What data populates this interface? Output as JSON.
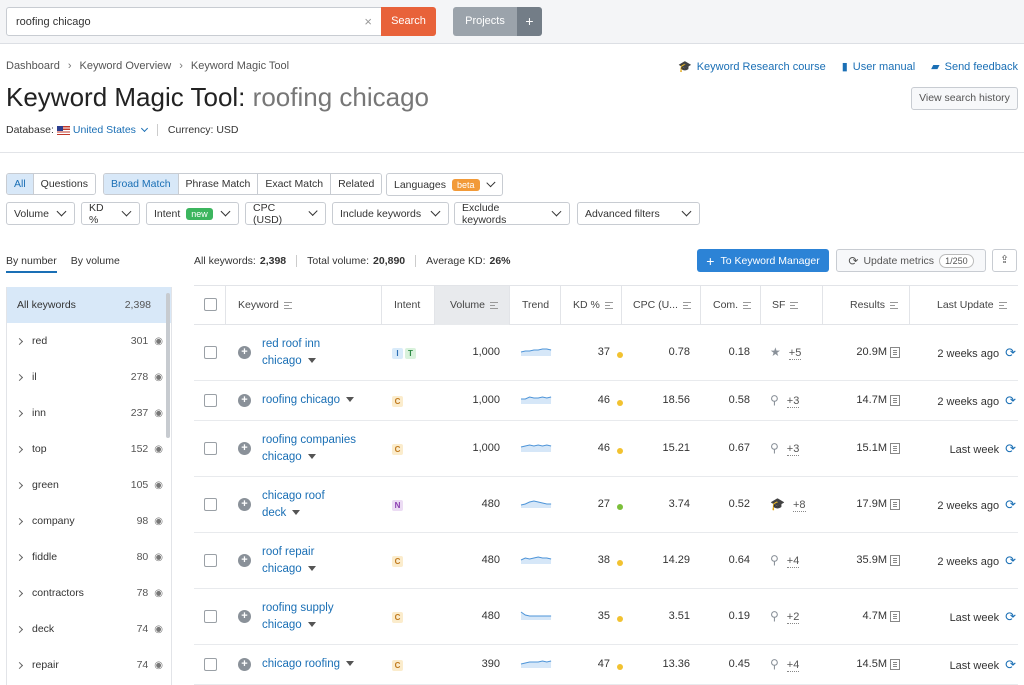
{
  "search": {
    "value": "roofing chicago",
    "clear": "×",
    "button": "Search"
  },
  "projects": {
    "label": "Projects",
    "plus": "+"
  },
  "breadcrumb": [
    "Dashboard",
    "Keyword Overview",
    "Keyword Magic Tool"
  ],
  "breadcrumb_sep": "›",
  "top_links": [
    "Keyword Research course",
    "User manual",
    "Send feedback"
  ],
  "title": {
    "tool": "Keyword Magic Tool:",
    "query": "roofing chicago"
  },
  "history_button": "View search history",
  "database": {
    "label": "Database:",
    "country": "United States",
    "currency": "Currency: USD"
  },
  "match_tabs_a": [
    "All",
    "Questions"
  ],
  "match_tabs_b": [
    "Broad Match",
    "Phrase Match",
    "Exact Match",
    "Related"
  ],
  "languages": {
    "label": "Languages",
    "badge": "beta"
  },
  "filters": {
    "volume": "Volume",
    "kd": "KD %",
    "intent": "Intent",
    "intent_badge": "new",
    "cpc": "CPC (USD)",
    "include": "Include keywords",
    "exclude": "Exclude keywords",
    "advanced": "Advanced filters"
  },
  "left_panel": {
    "tabs": [
      "By number",
      "By volume"
    ],
    "all": {
      "label": "All keywords",
      "count": "2,398"
    },
    "groups": [
      {
        "label": "red",
        "count": "301"
      },
      {
        "label": "il",
        "count": "278"
      },
      {
        "label": "inn",
        "count": "237"
      },
      {
        "label": "top",
        "count": "152"
      },
      {
        "label": "green",
        "count": "105"
      },
      {
        "label": "company",
        "count": "98"
      },
      {
        "label": "fiddle",
        "count": "80"
      },
      {
        "label": "contractors",
        "count": "78"
      },
      {
        "label": "deck",
        "count": "74"
      },
      {
        "label": "repair",
        "count": "74"
      }
    ]
  },
  "summary": {
    "all_label": "All keywords:",
    "all_value": "2,398",
    "vol_label": "Total volume:",
    "vol_value": "20,890",
    "kd_label": "Average KD:",
    "kd_value": "26%"
  },
  "buttons": {
    "keyword_manager": "To Keyword Manager",
    "update_metrics": "Update metrics",
    "update_count": "1/250"
  },
  "table": {
    "headers": [
      "Keyword",
      "Intent",
      "Volume",
      "Trend",
      "KD %",
      "CPC (U...",
      "Com.",
      "SF",
      "Results",
      "Last Update"
    ],
    "rows": [
      {
        "kw1": "red roof inn",
        "kw2": "chicago",
        "intents": [
          "I",
          "T"
        ],
        "volume": "1,000",
        "trend": [
          6,
          5,
          5,
          4,
          4,
          3,
          3,
          4
        ],
        "kd": "37",
        "kd_color": "#f2c230",
        "cpc": "0.78",
        "com": "0.18",
        "sf_icon": "★",
        "sf_name": "star-icon",
        "sf": "+5",
        "results": "20.9M",
        "last": "2 weeks ago"
      },
      {
        "kw1": "roofing chicago",
        "kw2": "",
        "intents": [
          "C"
        ],
        "volume": "1,000",
        "trend": [
          5,
          5,
          3,
          4,
          4,
          3,
          4,
          3
        ],
        "kd": "46",
        "kd_color": "#f2c230",
        "cpc": "18.56",
        "com": "0.58",
        "sf_icon": "⚲",
        "sf_name": "location-pin-icon",
        "sf": "+3",
        "results": "14.7M",
        "last": "2 weeks ago"
      },
      {
        "kw1": "roofing companies",
        "kw2": "chicago",
        "intents": [
          "C"
        ],
        "volume": "1,000",
        "trend": [
          5,
          4,
          3,
          4,
          3,
          4,
          3,
          4
        ],
        "kd": "46",
        "kd_color": "#f2c230",
        "cpc": "15.21",
        "com": "0.67",
        "sf_icon": "⚲",
        "sf_name": "location-pin-icon",
        "sf": "+3",
        "results": "15.1M",
        "last": "Last week"
      },
      {
        "kw1": "chicago roof",
        "kw2": "deck",
        "intents": [
          "N"
        ],
        "volume": "480",
        "trend": [
          7,
          6,
          4,
          3,
          4,
          5,
          6,
          6
        ],
        "kd": "27",
        "kd_color": "#7cbf3a",
        "cpc": "3.74",
        "com": "0.52",
        "sf_icon": "🎓",
        "sf_name": "graduation-cap-icon",
        "sf": "+8",
        "results": "17.9M",
        "last": "2 weeks ago"
      },
      {
        "kw1": "roof repair",
        "kw2": "chicago",
        "intents": [
          "C"
        ],
        "volume": "480",
        "trend": [
          6,
          4,
          5,
          4,
          3,
          4,
          4,
          5
        ],
        "kd": "38",
        "kd_color": "#f2c230",
        "cpc": "14.29",
        "com": "0.64",
        "sf_icon": "⚲",
        "sf_name": "location-pin-icon",
        "sf": "+4",
        "results": "35.9M",
        "last": "2 weeks ago"
      },
      {
        "kw1": "roofing supply",
        "kw2": "chicago",
        "intents": [
          "C"
        ],
        "volume": "480",
        "trend": [
          2,
          5,
          6,
          6,
          6,
          6,
          6,
          6
        ],
        "kd": "35",
        "kd_color": "#f2c230",
        "cpc": "3.51",
        "com": "0.19",
        "sf_icon": "⚲",
        "sf_name": "location-pin-icon",
        "sf": "+2",
        "results": "4.7M",
        "last": "Last week"
      },
      {
        "kw1": "chicago roofing",
        "kw2": "",
        "intents": [
          "C"
        ],
        "volume": "390",
        "trend": [
          6,
          5,
          4,
          4,
          4,
          3,
          4,
          3
        ],
        "kd": "47",
        "kd_color": "#f2c230",
        "cpc": "13.36",
        "com": "0.45",
        "sf_icon": "⚲",
        "sf_name": "location-pin-icon",
        "sf": "+4",
        "results": "14.5M",
        "last": "Last week"
      }
    ]
  },
  "colors": {
    "accent": "#1a6fb5",
    "search_button": "#e8623a",
    "primary_button": "#2c83d6"
  }
}
